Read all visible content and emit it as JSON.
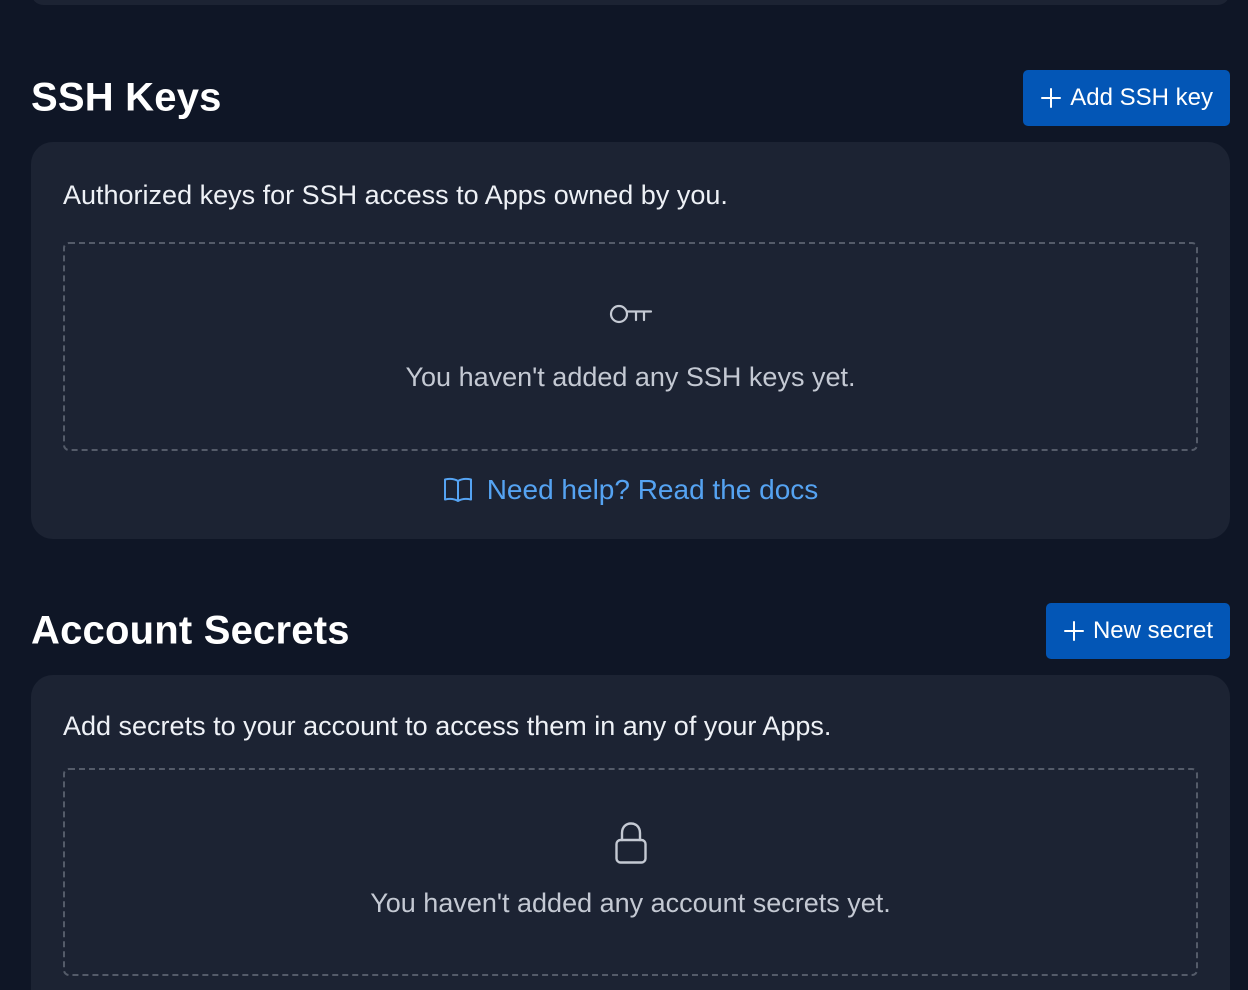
{
  "ssh_keys": {
    "title": "SSH Keys",
    "add_button_label": "Add SSH key",
    "description": "Authorized keys for SSH access to Apps owned by you.",
    "empty_message": "You haven't added any SSH keys yet.",
    "docs_link_label": "Need help? Read the docs",
    "empty_icon": "key-icon"
  },
  "account_secrets": {
    "title": "Account Secrets",
    "new_button_label": "New secret",
    "description": "Add secrets to your account to access them in any of your Apps.",
    "empty_message": "You haven't added any account secrets yet.",
    "empty_icon": "lock-icon"
  },
  "colors": {
    "page_background": "#0f1626",
    "card_background": "#1c2333",
    "primary_button": "#0356b6",
    "link": "#55a3f2",
    "dashed_border": "#545b69"
  }
}
